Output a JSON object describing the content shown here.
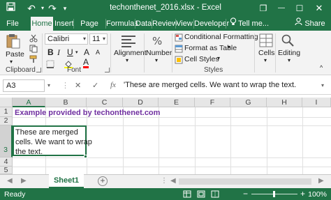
{
  "title_bar": {
    "title": "techonthenet_2016.xlsx - Excel",
    "restore_glyph": "❐",
    "minimize_glyph": "—",
    "maximize_glyph": "☐",
    "close_glyph": "✕"
  },
  "tabs": [
    {
      "label": "File"
    },
    {
      "label": "Home"
    },
    {
      "label": "Insert"
    },
    {
      "label": "Page Layo"
    },
    {
      "label": "Formulas"
    },
    {
      "label": "Data"
    },
    {
      "label": "Review"
    },
    {
      "label": "View"
    },
    {
      "label": "Developer"
    }
  ],
  "tell_me": "Tell me...",
  "share": "Share",
  "ribbon": {
    "paste": "Paste",
    "clipboard": "Clipboard",
    "font_name": "Calibri",
    "font_size": "11",
    "font": "Font",
    "alignment": "Alignment",
    "number": "Number",
    "conditional_formatting": "Conditional Formatting",
    "format_as_table": "Format as Table",
    "cell_styles": "Cell Styles",
    "styles": "Styles",
    "cells": "Cells",
    "editing": "Editing",
    "bold": "B",
    "italic": "I",
    "underline": "U",
    "grow_font": "A",
    "shrink_font": "A",
    "font_color": "A"
  },
  "formula_bar": {
    "name_box": "A3",
    "cancel": "✕",
    "enter": "✓",
    "fx": "fx",
    "content": "'These are merged cells. We want to wrap the text."
  },
  "columns": [
    "A",
    "B",
    "C",
    "D",
    "E",
    "F",
    "G",
    "H",
    "I"
  ],
  "rows": [
    "1",
    "2",
    "3",
    "4",
    "5"
  ],
  "cells": {
    "a1": "Example provided by techonthenet.com",
    "a3_lines": [
      "These are merged",
      "cells. We want to wrap",
      "the text."
    ]
  },
  "sheets": [
    {
      "name": "Sheet1"
    }
  ],
  "status": {
    "ready": "Ready",
    "zoom": "100%",
    "minus": "−",
    "plus": "+"
  },
  "colors": {
    "accent": "#217346",
    "a1_text": "#7030a0"
  }
}
